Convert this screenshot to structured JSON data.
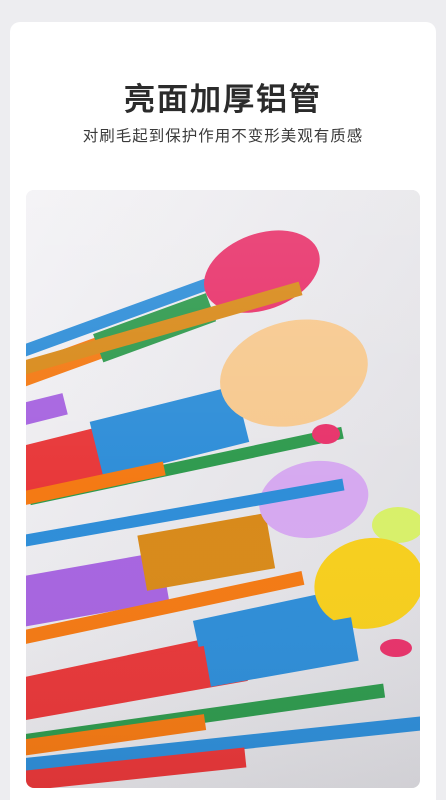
{
  "heading": {
    "title": "亮面加厚铝管",
    "subtitle": "对刷毛起到保护作用不变形美观有质感"
  },
  "photo": {
    "subject": "makeup-brushes-rainbow-handles",
    "colors": {
      "pink": "#e8336b",
      "peach": "#f7c98f",
      "lilac": "#d6a9f0",
      "lime": "#d8f06a",
      "yellow": "#f7cf1e",
      "blue": "#2f8ed8",
      "orange": "#f47a14",
      "red": "#e8383a",
      "purple": "#a765e0",
      "green": "#2f9a4e",
      "gold": "#d88a1a"
    }
  }
}
